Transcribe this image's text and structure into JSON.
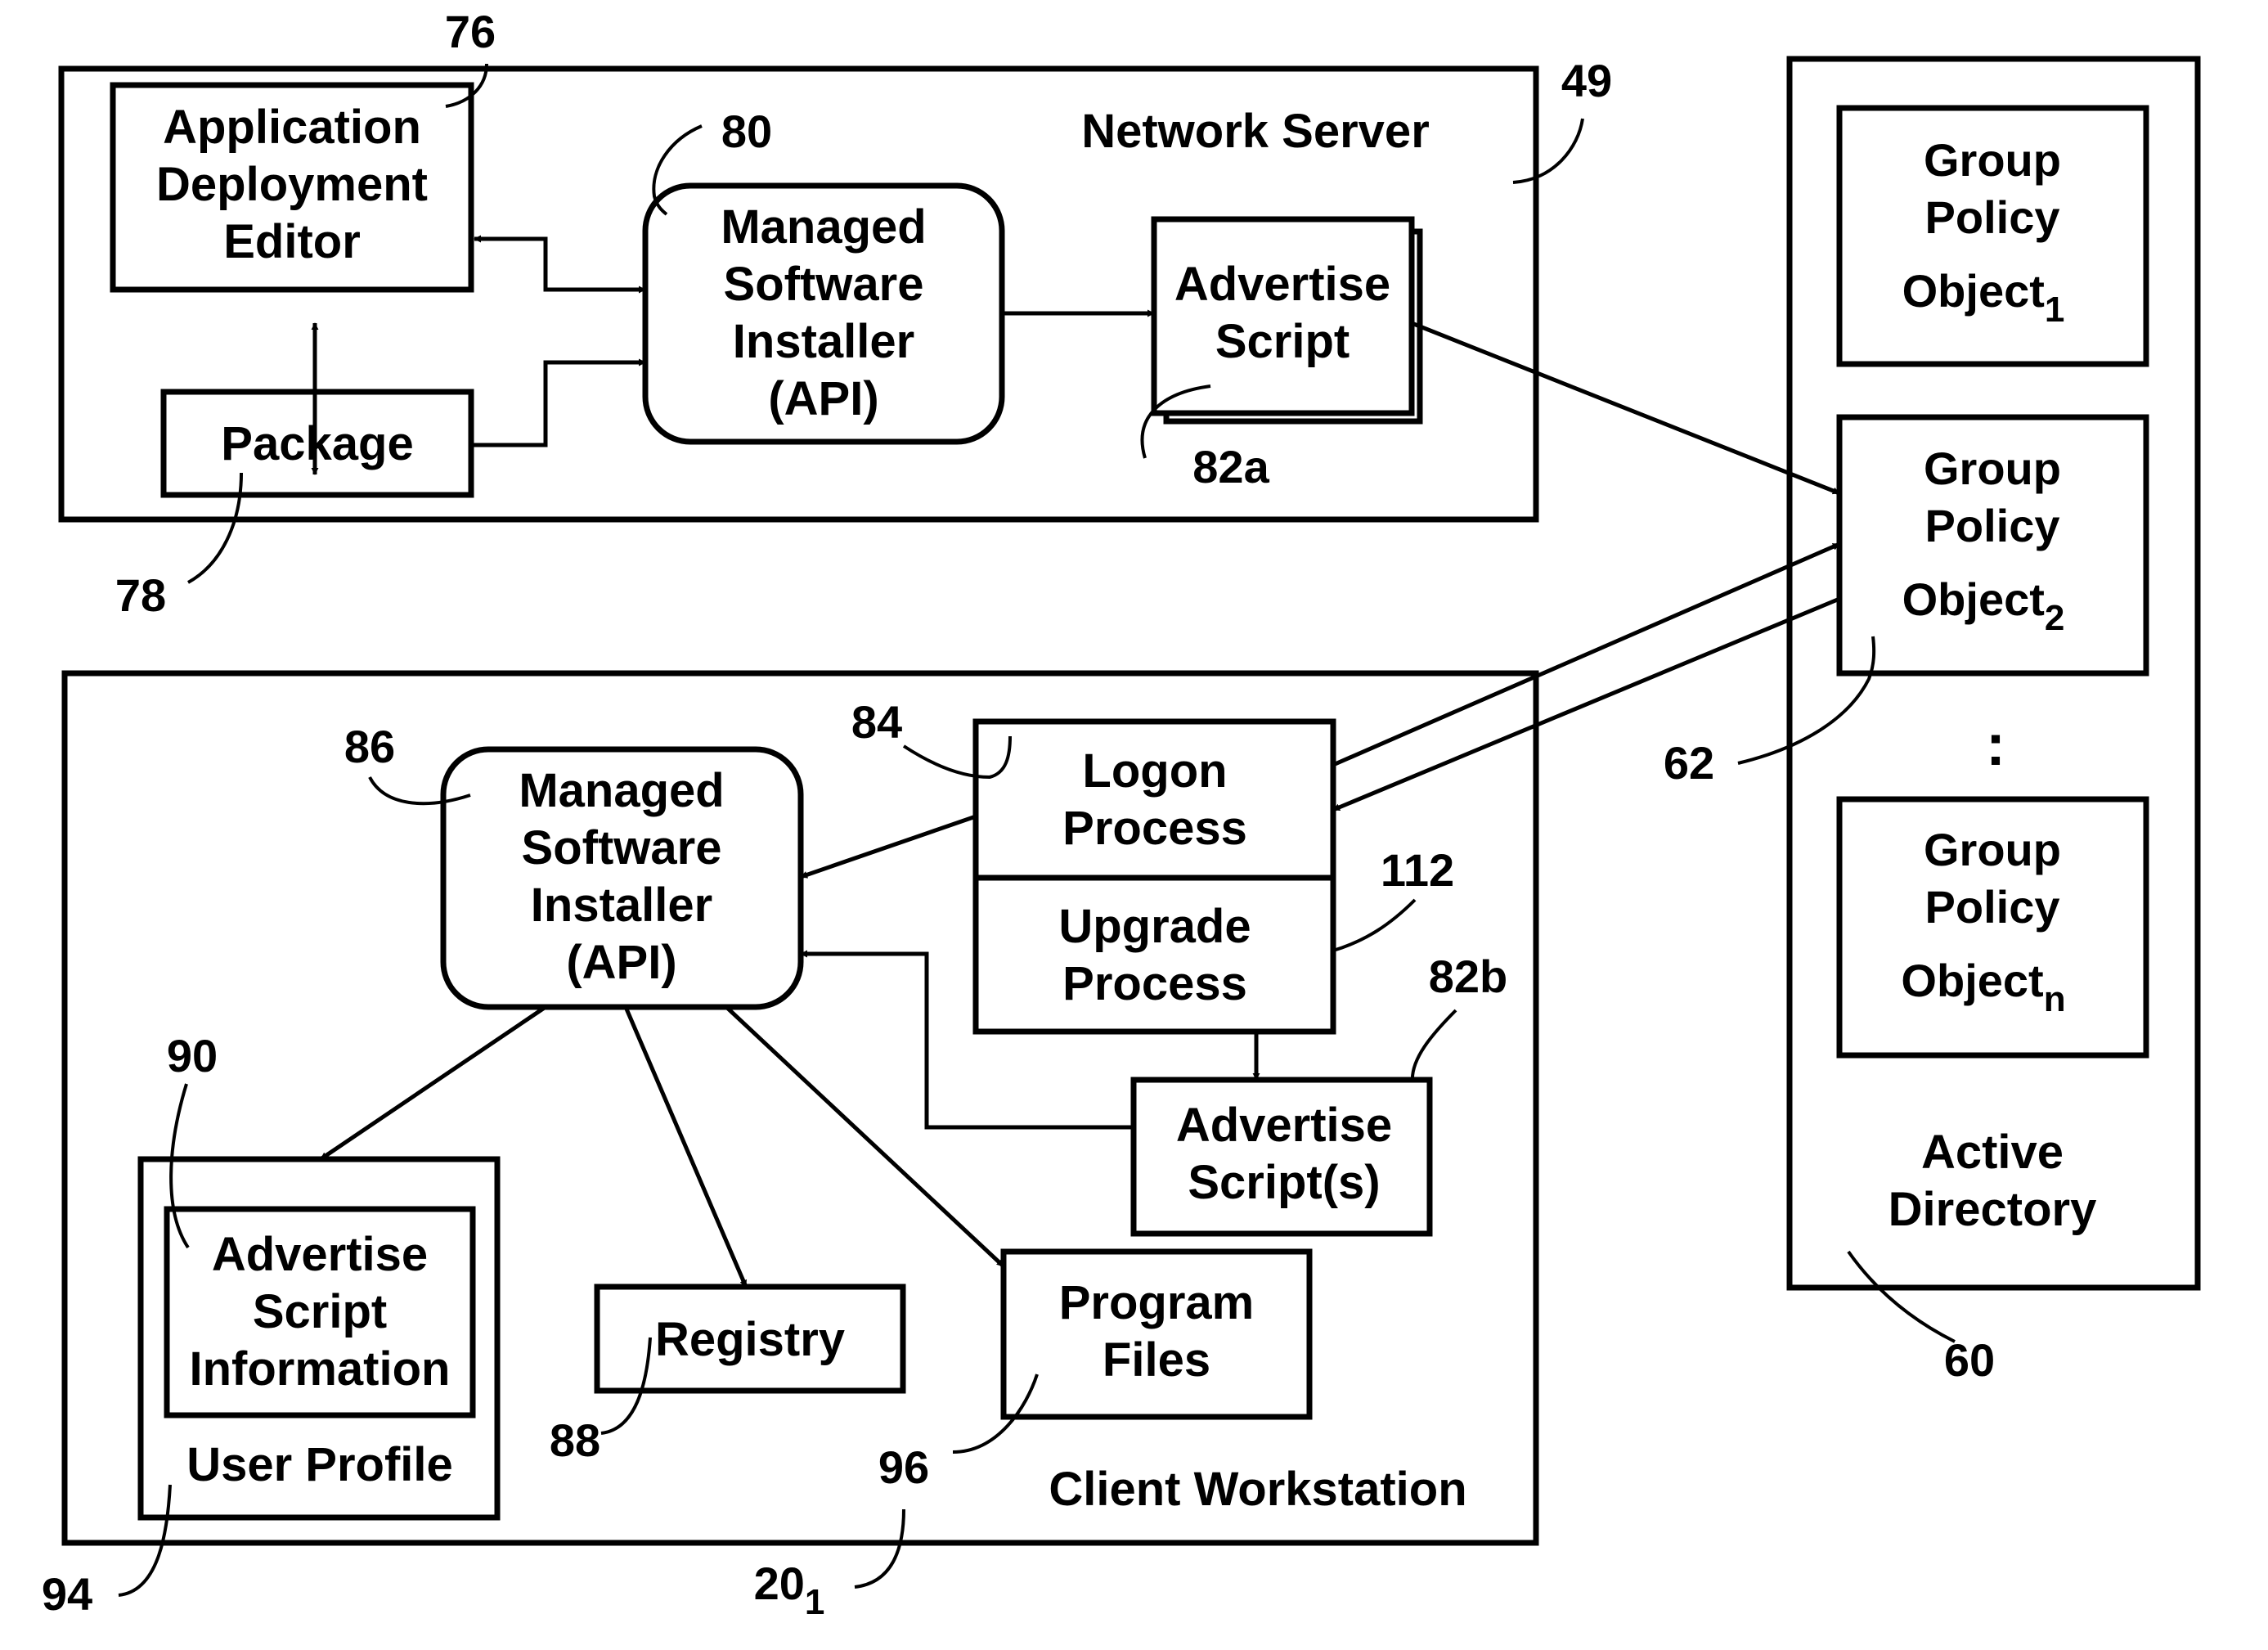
{
  "network_server": {
    "title": "Network Server",
    "ref": "49",
    "app_deployment_editor": {
      "lines": [
        "Application",
        "Deployment",
        "Editor"
      ],
      "ref": "76"
    },
    "package": {
      "label": "Package",
      "ref": "78"
    },
    "managed_software_installer": {
      "lines": [
        "Managed",
        "Software",
        "Installer",
        "(API)"
      ],
      "ref": "80"
    },
    "advertise_script": {
      "lines": [
        "Advertise",
        "Script"
      ],
      "ref": "82a"
    }
  },
  "active_directory": {
    "lines": [
      "Active",
      "Directory"
    ],
    "ref": "60",
    "gpos": [
      {
        "lines": [
          "Group",
          "Policy"
        ],
        "base": "Object",
        "sub": "1"
      },
      {
        "lines": [
          "Group",
          "Policy"
        ],
        "base": "Object",
        "sub": "2",
        "ref": "62"
      },
      {
        "lines": [
          "Group",
          "Policy"
        ],
        "base": "Object",
        "sub": "n"
      }
    ],
    "ellipsis": ":"
  },
  "client_workstation": {
    "title": "Client Workstation",
    "ref_base": "20",
    "ref_sub": "1",
    "managed_software_installer": {
      "lines": [
        "Managed",
        "Software",
        "Installer",
        "(API)"
      ],
      "ref": "86"
    },
    "logon_process": {
      "lines": [
        "Logon",
        "Process"
      ],
      "ref": "84"
    },
    "upgrade_process": {
      "lines": [
        "Upgrade",
        "Process"
      ],
      "ref": "112"
    },
    "advertise_scripts": {
      "lines": [
        "Advertise",
        "Script(s)"
      ],
      "ref": "82b"
    },
    "user_profile": {
      "label": "User Profile",
      "ref": "94"
    },
    "advertise_script_information": {
      "lines": [
        "Advertise",
        "Script",
        "Information"
      ],
      "ref": "90"
    },
    "registry": {
      "label": "Registry",
      "ref": "88"
    },
    "program_files": {
      "lines": [
        "Program",
        "Files"
      ],
      "ref": "96"
    }
  }
}
